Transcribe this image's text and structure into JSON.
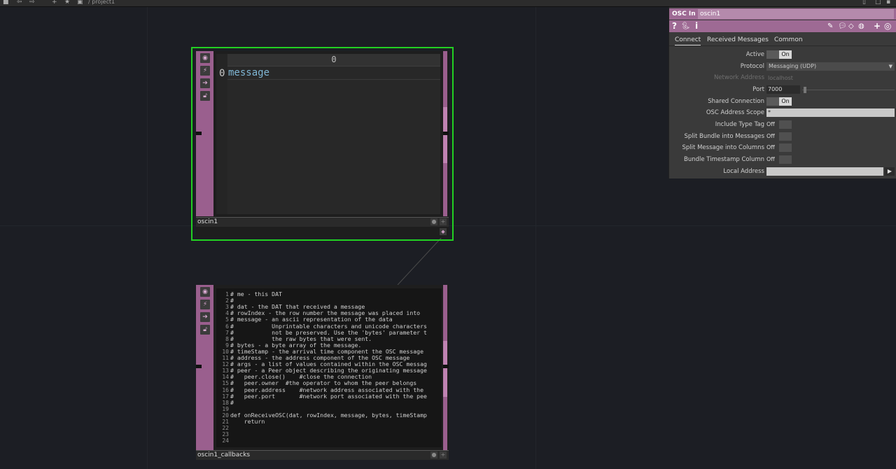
{
  "toolbar": {
    "path": "/ project1"
  },
  "table_node": {
    "name": "oscin1",
    "column_header": "0",
    "row_index": "0",
    "cell_value": "message"
  },
  "code_node": {
    "name": "oscin1_callbacks",
    "lines": [
      {
        "n": "1",
        "t": "# me - this DAT"
      },
      {
        "n": "2",
        "t": "#"
      },
      {
        "n": "3",
        "t": "# dat - the DAT that received a message"
      },
      {
        "n": "4",
        "t": "# rowIndex - the row number the message was placed into"
      },
      {
        "n": "5",
        "t": "# message - an ascii representation of the data"
      },
      {
        "n": "6",
        "t": "#           Unprintable characters and unicode characters"
      },
      {
        "n": "7",
        "t": "#           not be preserved. Use the 'bytes' parameter t"
      },
      {
        "n": "8",
        "t": "#           the raw bytes that were sent."
      },
      {
        "n": "9",
        "t": "# bytes - a byte array of the message."
      },
      {
        "n": "10",
        "t": "# timeStamp - the arrival time component the OSC message"
      },
      {
        "n": "11",
        "t": "# address - the address component of the OSC message"
      },
      {
        "n": "12",
        "t": "# args - a list of values contained within the OSC messag"
      },
      {
        "n": "13",
        "t": "# peer - a Peer object describing the originating message"
      },
      {
        "n": "14",
        "t": "#   peer.close()    #close the connection"
      },
      {
        "n": "15",
        "t": "#   peer.owner  #the operator to whom the peer belongs"
      },
      {
        "n": "16",
        "t": "#   peer.address    #network address associated with the"
      },
      {
        "n": "17",
        "t": "#   peer.port       #network port associated with the pee"
      },
      {
        "n": "18",
        "t": "#"
      },
      {
        "n": "19",
        "t": ""
      },
      {
        "n": "20",
        "t": "def onReceiveOSC(dat, rowIndex, message, bytes, timeStamp"
      },
      {
        "n": "21",
        "t": "    return"
      },
      {
        "n": "22",
        "t": ""
      },
      {
        "n": "23",
        "t": ""
      },
      {
        "n": "24",
        "t": ""
      }
    ]
  },
  "panel": {
    "op_type": "OSC In",
    "op_name": "oscin1",
    "tabs": [
      "Connect",
      "Received Messages",
      "Common"
    ],
    "params": {
      "active": {
        "label": "Active",
        "value": "On"
      },
      "protocol": {
        "label": "Protocol",
        "value": "Messaging (UDP)"
      },
      "network_address": {
        "label": "Network Address",
        "value": "localhost"
      },
      "port": {
        "label": "Port",
        "value": "7000"
      },
      "shared_connection": {
        "label": "Shared Connection",
        "value": "On"
      },
      "osc_address_scope": {
        "label": "OSC Address Scope",
        "value": "*"
      },
      "include_type_tag": {
        "label": "Include Type Tag",
        "value": "Off"
      },
      "split_bundle": {
        "label": "Split Bundle into Messages",
        "value": "Off"
      },
      "split_message": {
        "label": "Split Message into Columns",
        "value": "Off"
      },
      "bundle_timestamp": {
        "label": "Bundle Timestamp Column",
        "value": "Off"
      },
      "local_address": {
        "label": "Local Address",
        "value": ""
      }
    }
  }
}
